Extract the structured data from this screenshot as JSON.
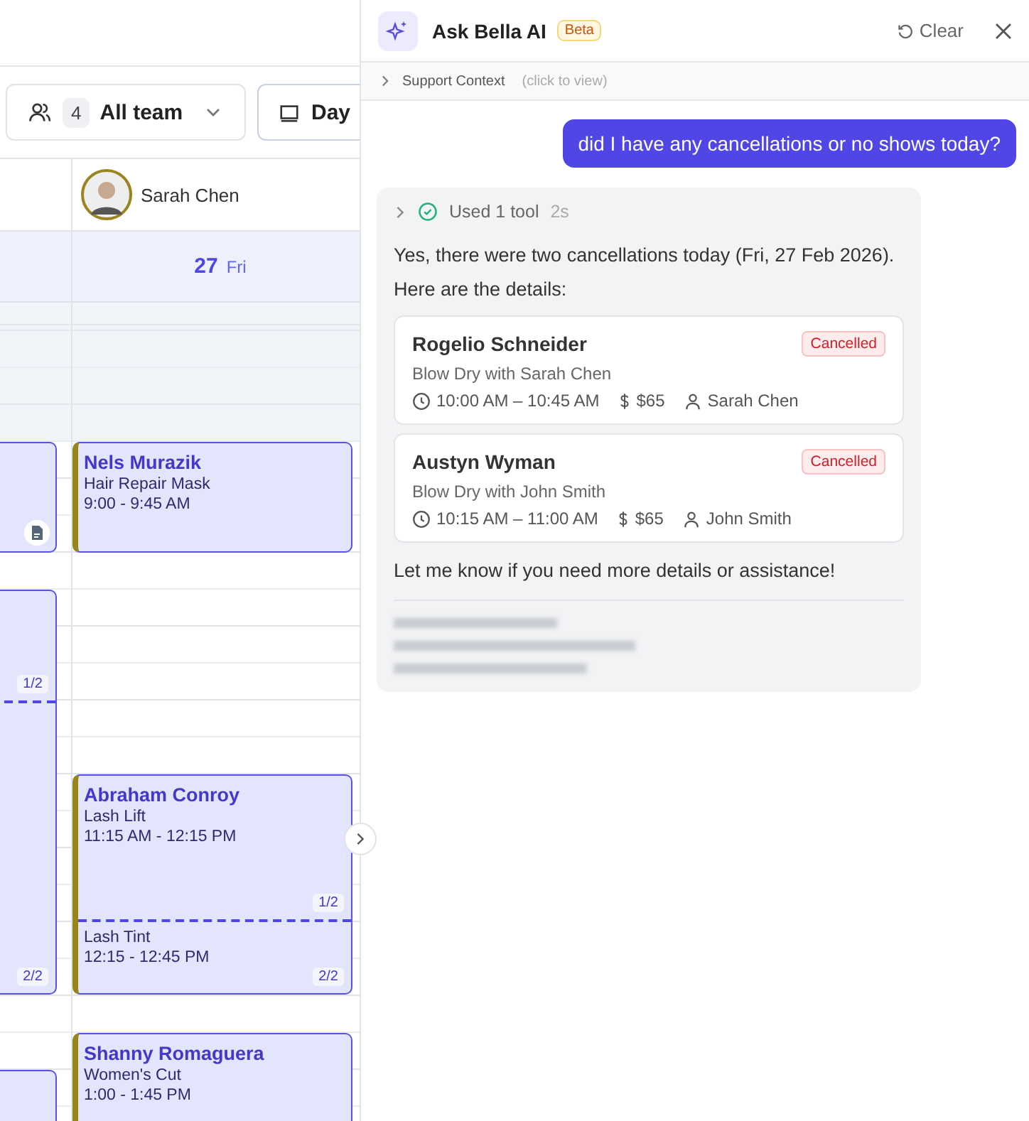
{
  "toolbar": {
    "team_filter": {
      "count": "4",
      "label": "All team"
    },
    "view_select": {
      "label": "Day"
    }
  },
  "staff_column": {
    "name": "Sarah Chen"
  },
  "date_header": {
    "day": "27",
    "weekday": "Fri"
  },
  "left_events": [
    {
      "kind": "note"
    },
    {
      "kind": "split",
      "parts": [
        "1/2",
        "2/2"
      ]
    },
    {
      "kind": "plain"
    }
  ],
  "events": [
    {
      "client": "Nels Murazik",
      "segments": [
        {
          "service": "Hair Repair Mask",
          "time": "9:00 - 9:45 AM"
        }
      ]
    },
    {
      "client": "Abraham Conroy",
      "segments": [
        {
          "service": "Lash Lift",
          "time": "11:15 AM - 12:15 PM",
          "part": "1/2"
        },
        {
          "service": "Lash Tint",
          "time": "12:15 - 12:45 PM",
          "part": "2/2"
        }
      ]
    },
    {
      "client": "Shanny Romaguera",
      "segments": [
        {
          "service": "Women's Cut",
          "time": "1:00 - 1:45 PM"
        }
      ]
    }
  ],
  "assistant": {
    "title": "Ask Bella AI",
    "badge": "Beta",
    "clear": "Clear",
    "context": {
      "label": "Support Context",
      "hint": "(click to view)",
      "expanded": false
    },
    "user_message": "did I have any cancellations or no shows today?",
    "reply": {
      "tool": {
        "label": "Used 1 tool",
        "duration": "2s",
        "expanded": false
      },
      "intro": "Yes, there were two cancellations today (Fri, 27 Feb 2026). Here are the details:",
      "cards": [
        {
          "client": "Rogelio Schneider",
          "status": "Cancelled",
          "service": "Blow Dry with Sarah Chen",
          "time": "10:00 AM – 10:45 AM",
          "price": "$65",
          "staff": "Sarah Chen"
        },
        {
          "client": "Austyn Wyman",
          "status": "Cancelled",
          "service": "Blow Dry with John Smith",
          "time": "10:15 AM – 11:00 AM",
          "price": "$65",
          "staff": "John Smith"
        }
      ],
      "outro": "Let me know if you need more details or assistance!"
    }
  }
}
